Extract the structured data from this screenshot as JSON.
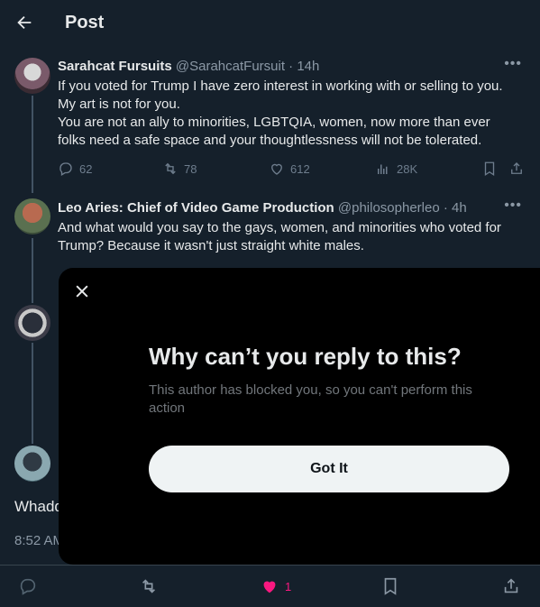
{
  "header": {
    "title": "Post"
  },
  "tweet1": {
    "name": "Sarahcat Fursuits",
    "handle": "@SarahcatFursuit",
    "time": "· 14h",
    "line1": "If you voted for Trump I have zero interest in working with or selling to you.",
    "line2": "My art is not for you.",
    "line3": "You are not an ally to minorities, LGBTQIA, women, now more than ever",
    "line4": "folks need a safe space and your thoughtlessness will not be tolerated.",
    "replies": "62",
    "reposts": "78",
    "likes": "612",
    "views": "28K"
  },
  "tweet2": {
    "name": "Leo Aries: Chief of Video Game Production",
    "handle": "@philosopherleo",
    "time": "· 4h",
    "line1": "And what would you say to the gays, women, and minorities who voted for",
    "line2": "Trump? Because it wasn't just straight white males."
  },
  "main_tweet": {
    "text_partial": "Whadd",
    "time_partial": "8:52 AM"
  },
  "bottom_bar": {
    "likes": "1"
  },
  "modal": {
    "title": "Why can’t you reply to this?",
    "text": "This author has blocked you, so you can't perform this action",
    "button": "Got It"
  },
  "colors": {
    "background": "#15202b",
    "modal": "#000000",
    "like_active": "#f91880",
    "muted": "#8b98a5"
  },
  "icons": [
    "back-arrow-icon",
    "more-icon",
    "reply-icon",
    "repost-icon",
    "like-icon",
    "views-icon",
    "bookmark-icon",
    "share-icon",
    "close-icon"
  ]
}
